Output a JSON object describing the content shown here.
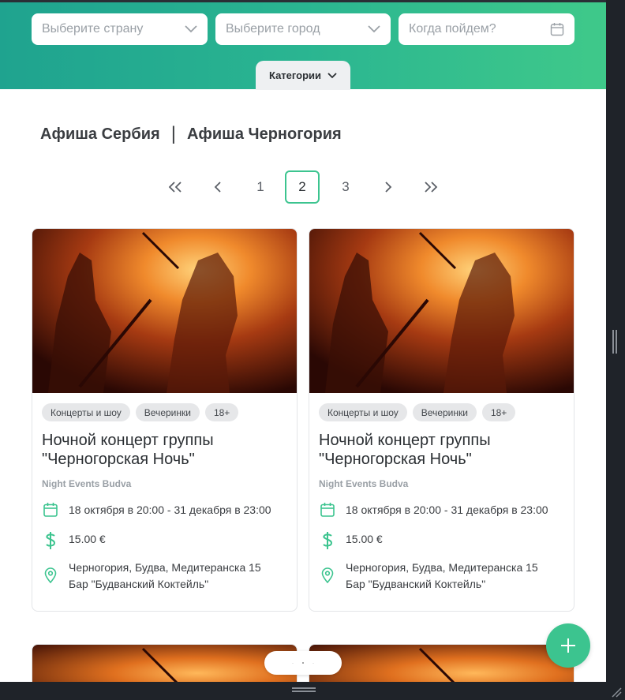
{
  "filters": {
    "country_placeholder": "Выберите страну",
    "city_placeholder": "Выберите город",
    "date_placeholder": "Когда пойдем?"
  },
  "categories_label": "Категории",
  "afisha": {
    "serbia": "Афиша Сербия",
    "separator": "|",
    "montenegro": "Афиша Черногория"
  },
  "pagination": {
    "first": "«",
    "prev": "‹",
    "pages": [
      "1",
      "2",
      "3"
    ],
    "current": "2",
    "next": "›",
    "last": "»"
  },
  "events": [
    {
      "tags": [
        "Концерты и шоу",
        "Вечеринки",
        "18+"
      ],
      "title": "Ночной концерт группы \"Черногорская Ночь\"",
      "organizer": "Night Events Budva",
      "dates": "18 октября в 20:00 - 31 декабря в 23:00",
      "price": "15.00  €",
      "address_line1": "Черногория, Будва, Медитеранска 15",
      "address_line2": "Бар \"Будванский Коктейль\""
    },
    {
      "tags": [
        "Концерты и шоу",
        "Вечеринки",
        "18+"
      ],
      "title": "Ночной концерт группы \"Черногорская Ночь\"",
      "organizer": "Night Events Budva",
      "dates": "18 октября в 20:00 - 31 декабря в 23:00",
      "price": "15.00  €",
      "address_line1": "Черногория, Будва, Медитеранска 15",
      "address_line2": "Бар \"Будванский Коктейль\""
    }
  ],
  "colors": {
    "accent": "#3cc48f",
    "header_start": "#1fa38f",
    "header_end": "#3fc98a"
  }
}
